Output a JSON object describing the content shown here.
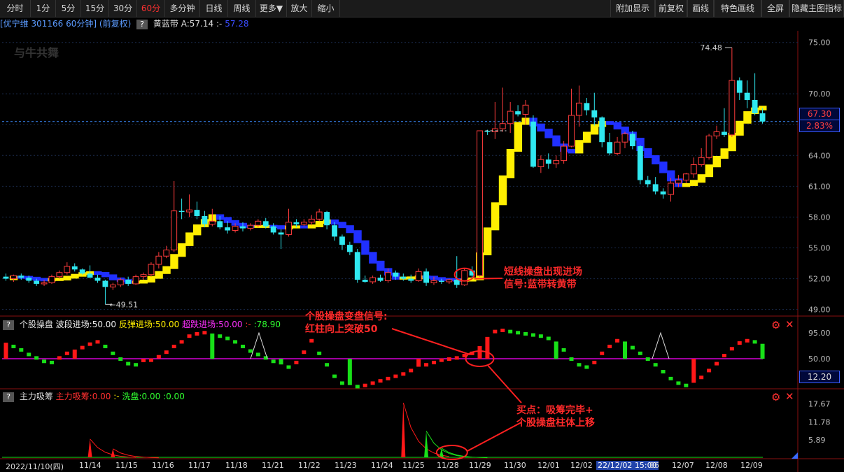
{
  "toolbar": {
    "left": [
      "分时",
      "1分",
      "5分",
      "15分",
      "30分",
      "60分",
      "多分钟",
      "日线",
      "周线",
      "更多▼",
      "放大",
      "缩小"
    ],
    "active": "60分",
    "right": [
      "附加显示",
      "前复权",
      "画线",
      "特色画线",
      "全屏",
      "隐藏主图指标"
    ]
  },
  "info": {
    "stock": "[优宁维 301166 60分钟] (前复权)",
    "qmark": "?",
    "indicator_name": "黄蓝带",
    "a_value": "A:57.14",
    "sep": ":-",
    "b_value": "57.28"
  },
  "logo": "与牛共舞",
  "main_axis": {
    "labels": [
      "75.00",
      "70.00",
      "67.00",
      "64.00",
      "61.00",
      "58.00",
      "55.00",
      "52.00",
      "49.00"
    ],
    "current_price": "67.30",
    "current_pct": "2.83%",
    "high_label": "74.48",
    "low_label": "49.51"
  },
  "panel2": {
    "name": "个股操盘",
    "l1": "波段进场:50.00",
    "l2": "反弹进场:50.00",
    "l3": "超跌进场:50.00",
    "l4": ":-",
    "l5": ":78.90",
    "axis": [
      "95.00",
      "50.00"
    ],
    "current": "12.20"
  },
  "panel3": {
    "name": "主力吸筹",
    "l1": "主力吸筹:0.00",
    "l2": ":-",
    "l3": "洗盘:0.00",
    "l4": ":0.00",
    "axis": [
      "17.67",
      "11.78",
      "5.89"
    ]
  },
  "x_axis": [
    "2022/11/10(四)",
    "11/14",
    "11/15",
    "11/16",
    "11/17",
    "11/18",
    "11/21",
    "11/22",
    "11/23",
    "11/24",
    "11/25",
    "11/28",
    "11/29",
    "11/30",
    "12/01",
    "12/02",
    "22/12/02 15:00",
    "06",
    "12/07",
    "12/08",
    "12/09"
  ],
  "annotations": {
    "a1_line1": "短线操盘出现进场",
    "a1_line2": "信号:蓝带转黄带",
    "a2_line1": "个股操盘变盘信号:",
    "a2_line2": "红柱向上突破50",
    "a3_line1": "买点：吸筹完毕+",
    "a3_line2": "个股操盘柱体上移"
  },
  "colors": {
    "up": "#ff3c3c",
    "down": "#2fe8f0",
    "band_yellow": "#ffee00",
    "band_blue": "#2030ff",
    "osc_red": "#ff1818",
    "osc_green": "#18e018",
    "purple": "#ff00ff"
  },
  "chart_data": {
    "type": "candlestick",
    "ylim": [
      48.5,
      76
    ],
    "candles": [
      [
        52.2,
        52.5,
        51.8,
        52.0
      ],
      [
        52.0,
        52.4,
        51.7,
        52.3
      ],
      [
        52.3,
        52.5,
        51.9,
        52.1
      ],
      [
        52.1,
        52.3,
        51.6,
        51.8
      ],
      [
        51.8,
        52.0,
        51.3,
        51.5
      ],
      [
        51.5,
        51.9,
        51.3,
        51.6
      ],
      [
        51.6,
        52.4,
        51.5,
        52.2
      ],
      [
        52.2,
        52.8,
        52.0,
        52.6
      ],
      [
        52.6,
        53.6,
        52.4,
        53.2
      ],
      [
        53.2,
        53.5,
        52.7,
        52.9
      ],
      [
        52.9,
        53.0,
        52.4,
        52.5
      ],
      [
        52.5,
        53.3,
        52.3,
        52.1
      ],
      [
        52.1,
        52.4,
        51.6,
        51.8
      ],
      [
        51.8,
        51.9,
        49.5,
        51.2
      ],
      [
        51.2,
        51.6,
        50.9,
        51.4
      ],
      [
        51.4,
        52.1,
        51.2,
        51.9
      ],
      [
        51.9,
        52.2,
        51.3,
        51.5
      ],
      [
        51.5,
        52.4,
        51.4,
        52.2
      ],
      [
        52.2,
        52.6,
        51.9,
        52.4
      ],
      [
        52.4,
        53.6,
        52.2,
        53.4
      ],
      [
        53.4,
        54.6,
        53.0,
        54.2
      ],
      [
        54.2,
        55.2,
        54.0,
        54.8
      ],
      [
        54.8,
        61.5,
        54.6,
        58.6
      ],
      [
        58.6,
        59.8,
        57.8,
        58.5
      ],
      [
        58.5,
        60.2,
        58.0,
        58.7
      ],
      [
        58.7,
        59.5,
        57.8,
        58.1
      ],
      [
        58.1,
        58.6,
        57.0,
        57.3
      ],
      [
        57.3,
        58.8,
        57.1,
        57.6
      ],
      [
        57.6,
        58.1,
        56.8,
        57.0
      ],
      [
        57.0,
        57.6,
        56.4,
        56.7
      ],
      [
        56.7,
        57.4,
        56.5,
        57.1
      ],
      [
        57.1,
        57.5,
        56.6,
        56.9
      ],
      [
        56.9,
        57.4,
        56.7,
        57.2
      ],
      [
        57.2,
        57.8,
        57.0,
        57.6
      ],
      [
        57.6,
        57.9,
        56.9,
        57.1
      ],
      [
        57.1,
        57.4,
        56.3,
        56.5
      ],
      [
        56.5,
        56.8,
        54.9,
        56.3
      ],
      [
        56.3,
        58.8,
        56.1,
        57.5
      ],
      [
        57.5,
        57.8,
        57.0,
        57.3
      ],
      [
        57.3,
        57.8,
        57.1,
        57.5
      ],
      [
        57.5,
        58.2,
        57.2,
        57.8
      ],
      [
        57.8,
        58.8,
        57.6,
        58.5
      ],
      [
        58.5,
        58.6,
        56.8,
        57.2
      ],
      [
        57.2,
        57.5,
        55.7,
        56.1
      ],
      [
        56.1,
        56.3,
        54.8,
        55.3
      ],
      [
        55.3,
        55.6,
        54.3,
        54.6
      ],
      [
        54.6,
        54.9,
        51.6,
        51.9
      ],
      [
        51.9,
        52.3,
        51.6,
        51.7
      ],
      [
        51.7,
        52.3,
        51.5,
        52.1
      ],
      [
        52.1,
        52.4,
        51.7,
        51.8
      ],
      [
        51.8,
        53.0,
        51.6,
        52.6
      ],
      [
        52.6,
        52.8,
        51.9,
        52.2
      ],
      [
        52.2,
        52.5,
        51.8,
        52.0
      ],
      [
        52.0,
        52.4,
        51.6,
        51.8
      ],
      [
        51.8,
        53.0,
        51.7,
        52.7
      ],
      [
        52.7,
        53.0,
        51.3,
        51.6
      ],
      [
        51.6,
        52.2,
        51.4,
        51.8
      ],
      [
        51.8,
        52.0,
        51.5,
        51.7
      ],
      [
        51.7,
        52.0,
        51.5,
        51.9
      ],
      [
        51.9,
        54.2,
        51.1,
        51.4
      ],
      [
        51.4,
        53.0,
        51.3,
        52.8
      ],
      [
        52.8,
        53.2,
        52.0,
        52.3
      ],
      [
        52.3,
        66.4,
        52.2,
        66.4
      ],
      [
        66.4,
        66.5,
        66.0,
        66.3
      ],
      [
        66.3,
        69.2,
        65.6,
        66.6
      ],
      [
        66.6,
        70.6,
        66.3,
        67.1
      ],
      [
        67.1,
        69.2,
        66.2,
        68.3
      ],
      [
        68.3,
        68.9,
        67.8,
        68.0
      ],
      [
        68.0,
        69.4,
        67.0,
        68.9
      ],
      [
        67.3,
        67.9,
        62.8,
        62.9
      ],
      [
        62.9,
        64.0,
        62.3,
        63.6
      ],
      [
        63.6,
        64.2,
        62.7,
        63.2
      ],
      [
        63.2,
        64.0,
        62.8,
        63.5
      ],
      [
        63.5,
        65.4,
        63.2,
        64.9
      ],
      [
        64.9,
        70.5,
        64.8,
        67.9
      ],
      [
        67.9,
        70.8,
        66.8,
        69.1
      ],
      [
        69.1,
        69.6,
        67.9,
        68.4
      ],
      [
        68.4,
        70.1,
        66.9,
        67.7
      ],
      [
        67.7,
        67.8,
        64.8,
        65.3
      ],
      [
        65.3,
        66.2,
        64.0,
        64.2
      ],
      [
        64.2,
        65.8,
        64.0,
        65.3
      ],
      [
        65.3,
        66.3,
        64.7,
        66.1
      ],
      [
        66.1,
        66.4,
        64.6,
        64.9
      ],
      [
        64.9,
        65.0,
        61.2,
        61.6
      ],
      [
        61.6,
        62.0,
        60.9,
        61.2
      ],
      [
        61.2,
        61.9,
        60.2,
        60.5
      ],
      [
        60.5,
        60.8,
        59.8,
        60.2
      ],
      [
        60.2,
        61.8,
        59.5,
        61.3
      ],
      [
        61.3,
        62.1,
        60.9,
        61.6
      ],
      [
        61.6,
        62.3,
        61.3,
        62.2
      ],
      [
        62.2,
        63.8,
        61.8,
        63.1
      ],
      [
        63.1,
        64.7,
        62.9,
        63.8
      ],
      [
        63.8,
        66.1,
        63.6,
        65.9
      ],
      [
        65.9,
        66.9,
        65.6,
        66.3
      ],
      [
        66.3,
        68.6,
        65.8,
        66.0
      ],
      [
        66.0,
        74.5,
        65.8,
        71.3
      ],
      [
        71.3,
        71.6,
        69.4,
        70.1
      ],
      [
        70.1,
        71.3,
        68.6,
        69.4
      ],
      [
        69.4,
        72.0,
        67.9,
        68.1
      ],
      [
        68.1,
        68.6,
        67.1,
        67.3
      ]
    ]
  }
}
